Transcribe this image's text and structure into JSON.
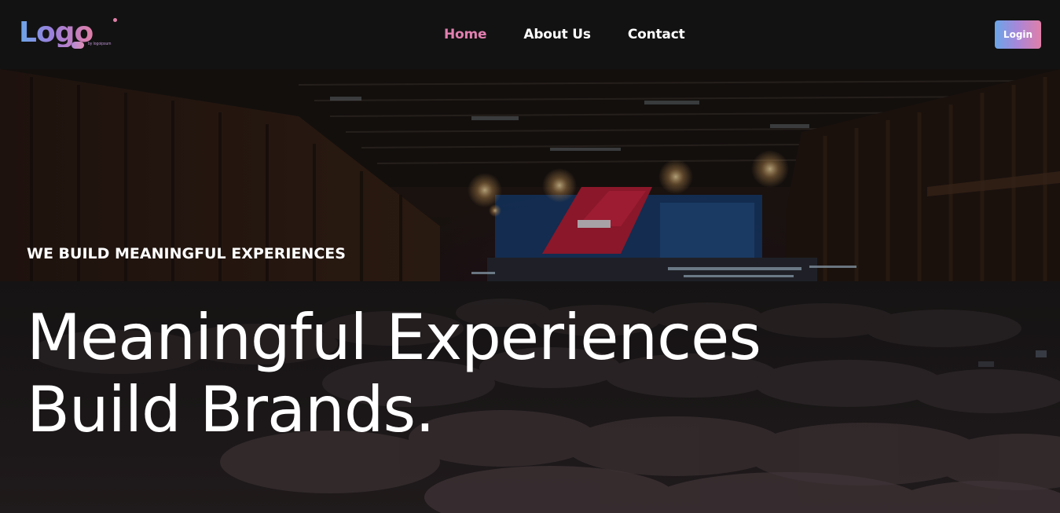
{
  "brand": {
    "logo_text": "Logo",
    "logo_sub": "by logoipsum"
  },
  "nav": {
    "items": [
      {
        "label": "Home",
        "active": true
      },
      {
        "label": "About Us",
        "active": false
      },
      {
        "label": "Contact",
        "active": false
      }
    ],
    "login_label": "Login"
  },
  "hero": {
    "eyebrow": "WE BUILD MEANINGFUL EXPERIENCES",
    "title_line1": "Meaningful Experiences",
    "title_line2": "Build Brands."
  },
  "colors": {
    "accent_pink": "#e27fb0",
    "gradient_start": "#6aa6e8",
    "gradient_end": "#e07fa8",
    "navbar_bg": "#121212"
  }
}
